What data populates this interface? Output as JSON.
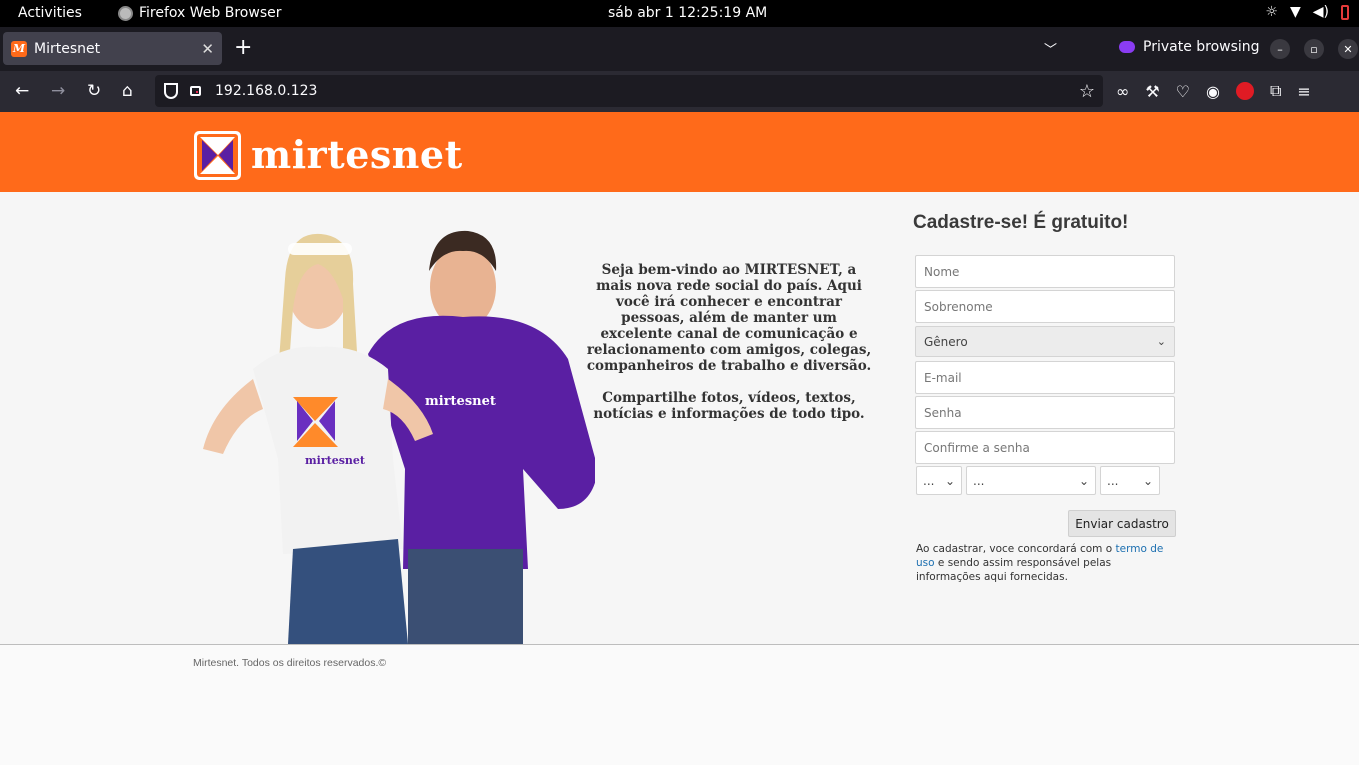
{
  "system_bar": {
    "activities": "Activities",
    "app_name": "Firefox Web Browser",
    "clock": "sáb abr 1  12:25:19 AM"
  },
  "browser": {
    "tab_title": "Mirtesnet",
    "favicon_letter": "M",
    "private_label": "Private browsing",
    "url": "192.168.0.123"
  },
  "site": {
    "logo_text": "mirtesnet",
    "shirt_text": "mirtesnet",
    "welcome_1": "Seja bem-vindo ao MIRTESNET, a  mais nova rede social do país. Aqui você irá conhecer e encontrar  pessoas, além de manter um  excelente canal de comunicação e  relacionamento com amigos,  colegas, companheiros de trabalho e  diversão.",
    "welcome_2": "Compartilhe fotos, vídeos, textos, notícias e informações de todo tipo."
  },
  "signup": {
    "title": "Cadastre-se! É gratuito!",
    "nome_placeholder": "Nome",
    "sobrenome_placeholder": "Sobrenome",
    "genero_value": "Gênero",
    "email_placeholder": "E-mail",
    "senha_placeholder": "Senha",
    "confirm_placeholder": "Confirme a senha",
    "day_value": "...",
    "month_value": "...",
    "year_value": "...",
    "submit_label": "Enviar cadastro",
    "terms_prefix": "Ao cadastrar, voce concordará com o ",
    "terms_link": "termo de uso",
    "terms_suffix": " e sendo assim responsável pelas informações aqui fornecidas."
  },
  "footer": {
    "copyright": "Mirtesnet. Todos os direitos reservados.©"
  },
  "colors": {
    "brand_orange": "#ff6a1a",
    "brand_purple": "#5a1fa3"
  }
}
